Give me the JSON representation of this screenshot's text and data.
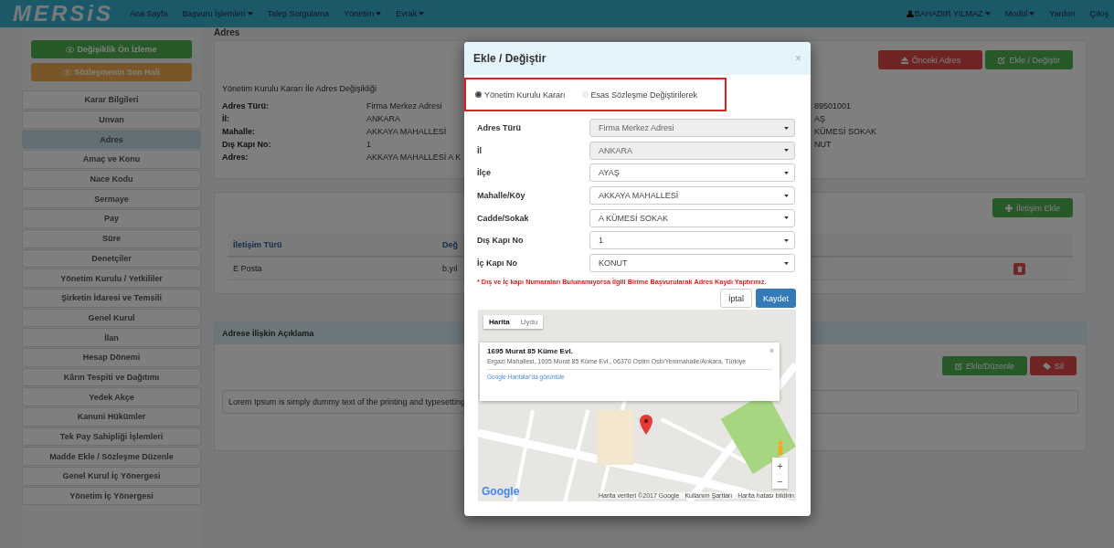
{
  "navbar": {
    "logo": "MERSiS",
    "items": [
      {
        "label": "Ana Sayfa",
        "dropdown": false
      },
      {
        "label": "Başvuru İşlemleri",
        "dropdown": true
      },
      {
        "label": "Talep Sorgulama",
        "dropdown": false
      },
      {
        "label": "Yönetim",
        "dropdown": true
      },
      {
        "label": "Evrak",
        "dropdown": true
      }
    ],
    "right": [
      {
        "label": "BAHADIR YILMAZ",
        "dropdown": true,
        "kind": "user"
      },
      {
        "label": "Modül",
        "dropdown": true,
        "kind": "link"
      },
      {
        "label": "Yardım",
        "dropdown": false,
        "kind": "link"
      },
      {
        "label": "Çıkış",
        "dropdown": false,
        "kind": "link"
      }
    ]
  },
  "page_heading": "Adres",
  "sidebar": {
    "buttons": [
      {
        "label": "Değişiklik Ön İzleme",
        "kind": "success"
      },
      {
        "label": "Sözleşmenin Son Hali",
        "kind": "warning"
      }
    ],
    "items": [
      {
        "label": "Karar Bilgileri",
        "selected": false
      },
      {
        "label": "Unvan",
        "selected": false
      },
      {
        "label": "Adres",
        "selected": true
      },
      {
        "label": "Amaç ve Konu",
        "selected": false
      },
      {
        "label": "Nace Kodu",
        "selected": false
      },
      {
        "label": "Sermaye",
        "selected": false
      },
      {
        "label": "Pay",
        "selected": false
      },
      {
        "label": "Süre",
        "selected": false
      },
      {
        "label": "Denetçiler",
        "selected": false
      },
      {
        "label": "Yönetim Kurulu / Yetkililer",
        "selected": false
      },
      {
        "label": "Şirketin İdaresi ve Temsili",
        "selected": false
      },
      {
        "label": "Genel Kurul",
        "selected": false
      },
      {
        "label": "İlan",
        "selected": false
      },
      {
        "label": "Hesap Dönemi",
        "selected": false
      },
      {
        "label": "Kârın Tespiti ve Dağıtımı",
        "selected": false
      },
      {
        "label": "Yedek Akçe",
        "selected": false
      },
      {
        "label": "Kanuni Hükümler",
        "selected": false
      },
      {
        "label": "Tek Pay Sahipliği İşlemleri",
        "selected": false
      },
      {
        "label": "Madde Ekle / Sözleşme Düzenle",
        "selected": false
      },
      {
        "label": "Genel Kurul İç Yönergesi",
        "selected": false
      },
      {
        "label": "Yönetim İç Yönergesi",
        "selected": false
      }
    ]
  },
  "address_panel": {
    "buttons": [
      {
        "label": "Önceki Adres",
        "kind": "danger"
      },
      {
        "label": "Ekle / Değiştir",
        "kind": "success"
      }
    ],
    "subtitle": "Yönetim Kurulu Kararı İle Adres Değişikliği",
    "details": [
      {
        "label": "Adres Türü:",
        "value": "Firma Merkez Adresi",
        "column_3": "89501001"
      },
      {
        "label": "İl:",
        "value": "ANKARA",
        "column_3": "AŞ"
      },
      {
        "label": "Mahalle:",
        "value": "AKKAYA MAHALLESİ",
        "column_3": "KÜMESİ SOKAK"
      },
      {
        "label": "Dış Kapı No:",
        "value": "1",
        "column_3": "NUT"
      },
      {
        "label": "Adres:",
        "value": "AKKAYA MAHALLESİ A K"
      }
    ]
  },
  "contact_panel": {
    "button": "İletişim Ekle",
    "columns": [
      "İletişim Türü",
      "Değ"
    ],
    "rows": [
      {
        "cells": [
          "E Posta",
          "b.yıl"
        ]
      }
    ]
  },
  "description_panel": {
    "title": "Adrese İlişkin Açıklama",
    "buttons": [
      {
        "label": "Ekle/Düzenle",
        "kind": "success"
      },
      {
        "label": "Sil",
        "kind": "danger"
      }
    ],
    "text": "Lorem Ipsum is simply dummy text of the printing and typesetting"
  },
  "modal": {
    "title": "Ekle / Değiştir",
    "close": "×",
    "options": [
      {
        "label": "Yönetim Kurulu Kararı",
        "selected": true
      },
      {
        "label": "Esas Sözleşme Değiştirilerek",
        "selected": false
      }
    ],
    "fields": [
      {
        "label": "Adres Türü",
        "value": "Firma Merkez Adresi",
        "disabled": true
      },
      {
        "label": "İl",
        "value": "ANKARA",
        "disabled": true
      },
      {
        "label": "İlçe",
        "value": "AYAŞ",
        "disabled": false
      },
      {
        "label": "Mahalle/Köy",
        "value": "AKKAYA MAHALLESİ",
        "disabled": false
      },
      {
        "label": "Cadde/Sokak",
        "value": "A KÜMESİ SOKAK",
        "disabled": false
      },
      {
        "label": "Dış Kapı No",
        "value": "1",
        "disabled": false
      },
      {
        "label": "İç Kapı No",
        "value": "KONUT",
        "disabled": false
      }
    ],
    "note": "* Dış ve İç kapı Numaraları Bulunamıyorsa İlgili Birime Başvurularak Adres Kaydı Yaptırınız.",
    "buttons": [
      {
        "label": "İptal",
        "kind": "default"
      },
      {
        "label": "Kaydet",
        "kind": "primary"
      }
    ],
    "map": {
      "types": [
        {
          "label": "Harita",
          "selected": true
        },
        {
          "label": "Uydu",
          "selected": false
        }
      ],
      "info": {
        "title": "1695 Murat 85 Küme Evl.",
        "address": "Ergazi Mahallesi, 1695 Murat 85 Küme Evl., 06370 Ostim Osb/Yenimahalle/Ankara, Türkiye",
        "link": "Google Haritalar'da görüntüle",
        "close": "×"
      },
      "zoom": [
        "+",
        "−"
      ],
      "logo": "Google",
      "attribution": [
        "Harita verileri ©2017 Google",
        "Kullanım Şartları",
        "Harita hatası bildirin"
      ]
    }
  }
}
